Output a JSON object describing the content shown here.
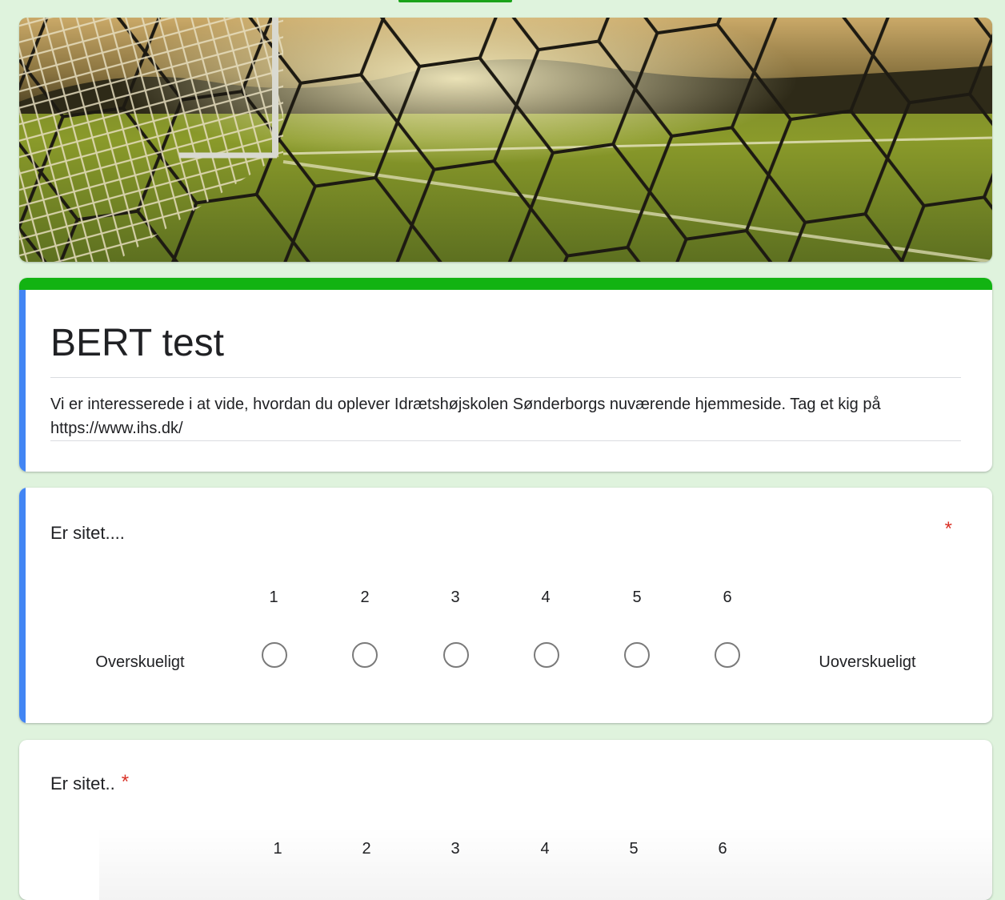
{
  "form": {
    "title": "BERT test",
    "description": "Vi er interesserede i at vide, hvordan du oplever Idrætshøjskolen Sønderborgs nuværende hjemmeside. Tag et kig på https://www.ihs.dk/",
    "theme_color": "#12b312",
    "background_color": "#dff3dd",
    "focus_color": "#4285f4"
  },
  "questions": [
    {
      "title": "Er sitet....",
      "required_mark": "*",
      "scale": [
        "1",
        "2",
        "3",
        "4",
        "5",
        "6"
      ],
      "low_label": "Overskueligt",
      "high_label": "Uoverskueligt"
    },
    {
      "title": "Er sitet..",
      "required_mark": "*",
      "scale": [
        "1",
        "2",
        "3",
        "4",
        "5",
        "6"
      ]
    }
  ]
}
